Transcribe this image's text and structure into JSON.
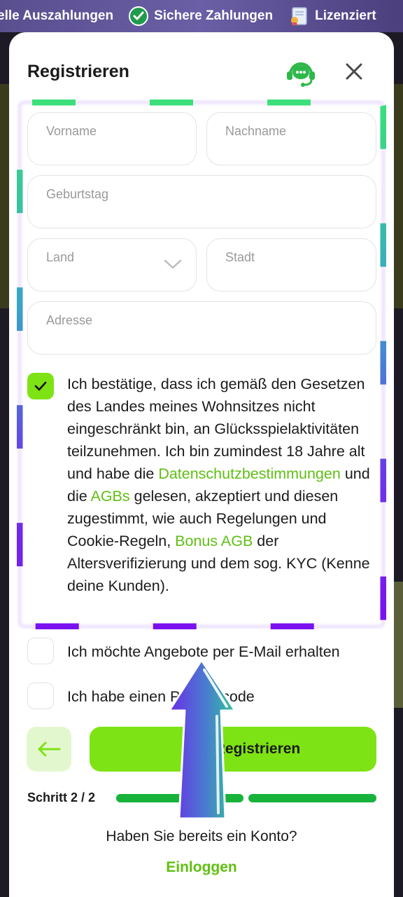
{
  "promo": {
    "item1": "elle Auszahlungen",
    "item2": "Sichere Zahlungen",
    "item3": "Lizenziert"
  },
  "modal": {
    "title": "Registrieren"
  },
  "form": {
    "first_name_placeholder": "Vorname",
    "last_name_placeholder": "Nachname",
    "birthday_placeholder": "Geburtstag",
    "country_placeholder": "Land",
    "city_placeholder": "Stadt",
    "address_placeholder": "Adresse"
  },
  "consent": {
    "checked": true,
    "text_part1": "Ich bestätige, dass ich gemäß den Gesetzen des Landes meines Wohnsitzes nicht eingeschränkt bin, an Glücksspielaktivitäten teilzunehmen. Ich bin zumindest 18 Jahre alt und habe die ",
    "link_privacy": "Datenschutzbestimmungen",
    "text_part2": " und die ",
    "link_terms": "AGBs",
    "text_part3": " gelesen, akzeptiert und diesen zugestimmt, wie auch Regelungen und Cookie-Regeln, ",
    "link_bonus": "Bonus AGB",
    "text_part4": " der Altersverifizierung und dem sog. KYC (Kenne deine Kunden)."
  },
  "offers": {
    "checked": false,
    "label": "Ich möchte Angebote per E-Mail erhalten"
  },
  "promocode": {
    "checked": false,
    "label": "Ich habe einen Promoscode"
  },
  "buttons": {
    "register_label": "Registrieren"
  },
  "steps": {
    "label": "Schritt 2 / 2",
    "current": 2,
    "total": 2
  },
  "footer": {
    "question": "Haben Sie bereits ein Konto?",
    "login_label": "Einloggen"
  },
  "colors": {
    "accent_green": "#7ee314",
    "link_green": "#5fbf12",
    "progress_green": "#17b33a",
    "frame_gradient": [
      "#3be07a",
      "#3aa1c9",
      "#6a3ae8",
      "#7a10f0"
    ]
  }
}
